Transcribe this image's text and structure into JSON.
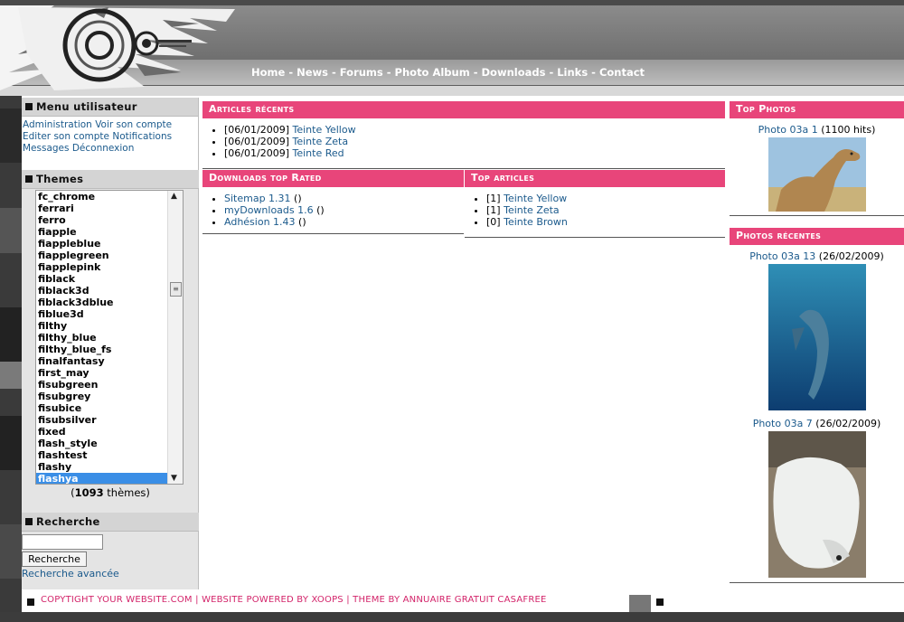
{
  "nav": {
    "items": [
      "Home",
      "News",
      "Forums",
      "Photo Album",
      "Downloads",
      "Links",
      "Contact"
    ],
    "separator": "-"
  },
  "user_menu": {
    "title": "Menu utilisateur",
    "links": [
      "Administration",
      "Voir son compte",
      "Editer son compte",
      "Notifications",
      "Messages",
      "Déconnexion"
    ]
  },
  "themes": {
    "title": "Themes",
    "options": [
      "fc_chrome",
      "ferrari",
      "ferro",
      "fiapple",
      "fiappleblue",
      "fiapplegreen",
      "fiapplepink",
      "fiblack",
      "fiblack3d",
      "fiblack3dblue",
      "fiblue3d",
      "filthy",
      "filthy_blue",
      "filthy_blue_fs",
      "finalfantasy",
      "first_may",
      "fisubgreen",
      "fisubgrey",
      "fisubice",
      "fisubsilver",
      "fixed",
      "flash_style",
      "flashtest",
      "flashy",
      "flashya"
    ],
    "selected": "flashya",
    "count_prefix": "(",
    "count": "1093",
    "count_suffix": " thèmes)"
  },
  "search": {
    "title": "Recherche",
    "input_value": "",
    "button_label": "Recherche",
    "advanced_link": "Recherche avancée"
  },
  "recent_articles": {
    "title": "Articles récents",
    "items": [
      {
        "date": "[06/01/2009]",
        "label": "Teinte Yellow"
      },
      {
        "date": "[06/01/2009]",
        "label": "Teinte Zeta"
      },
      {
        "date": "[06/01/2009]",
        "label": "Teinte Red"
      }
    ]
  },
  "downloads_top": {
    "title": "Downloads top Rated",
    "items": [
      {
        "label": "Sitemap 1.31",
        "suffix": " ()"
      },
      {
        "label": "myDownloads 1.6",
        "suffix": " ()"
      },
      {
        "label": "Adhésion 1.43",
        "suffix": " ()"
      }
    ]
  },
  "top_articles": {
    "title": "Top articles",
    "items": [
      {
        "count": "[1]",
        "label": "Teinte Yellow"
      },
      {
        "count": "[1]",
        "label": "Teinte Zeta"
      },
      {
        "count": "[0]",
        "label": "Teinte Brown"
      }
    ]
  },
  "top_photos": {
    "title": "Top Photos",
    "photo_label": "Photo 03a 1",
    "photo_meta": " (1100 hits)"
  },
  "recent_photos": {
    "title": "Photos récentes",
    "photos": [
      {
        "label": "Photo 03a 13",
        "meta": " (26/02/2009)"
      },
      {
        "label": "Photo 03a 7",
        "meta": " (26/02/2009)"
      }
    ]
  },
  "footer": {
    "text": "COPYTIGHT YOUR WEBSITE.COM | WEBSITE POWERED BY XOOPS | THEME BY ANNUAIRE GRATUIT CASAFREE"
  },
  "colors": {
    "accent_pink": "#e8457a",
    "link_blue": "#1b5a8c",
    "selected_blue": "#3a8ee6"
  }
}
